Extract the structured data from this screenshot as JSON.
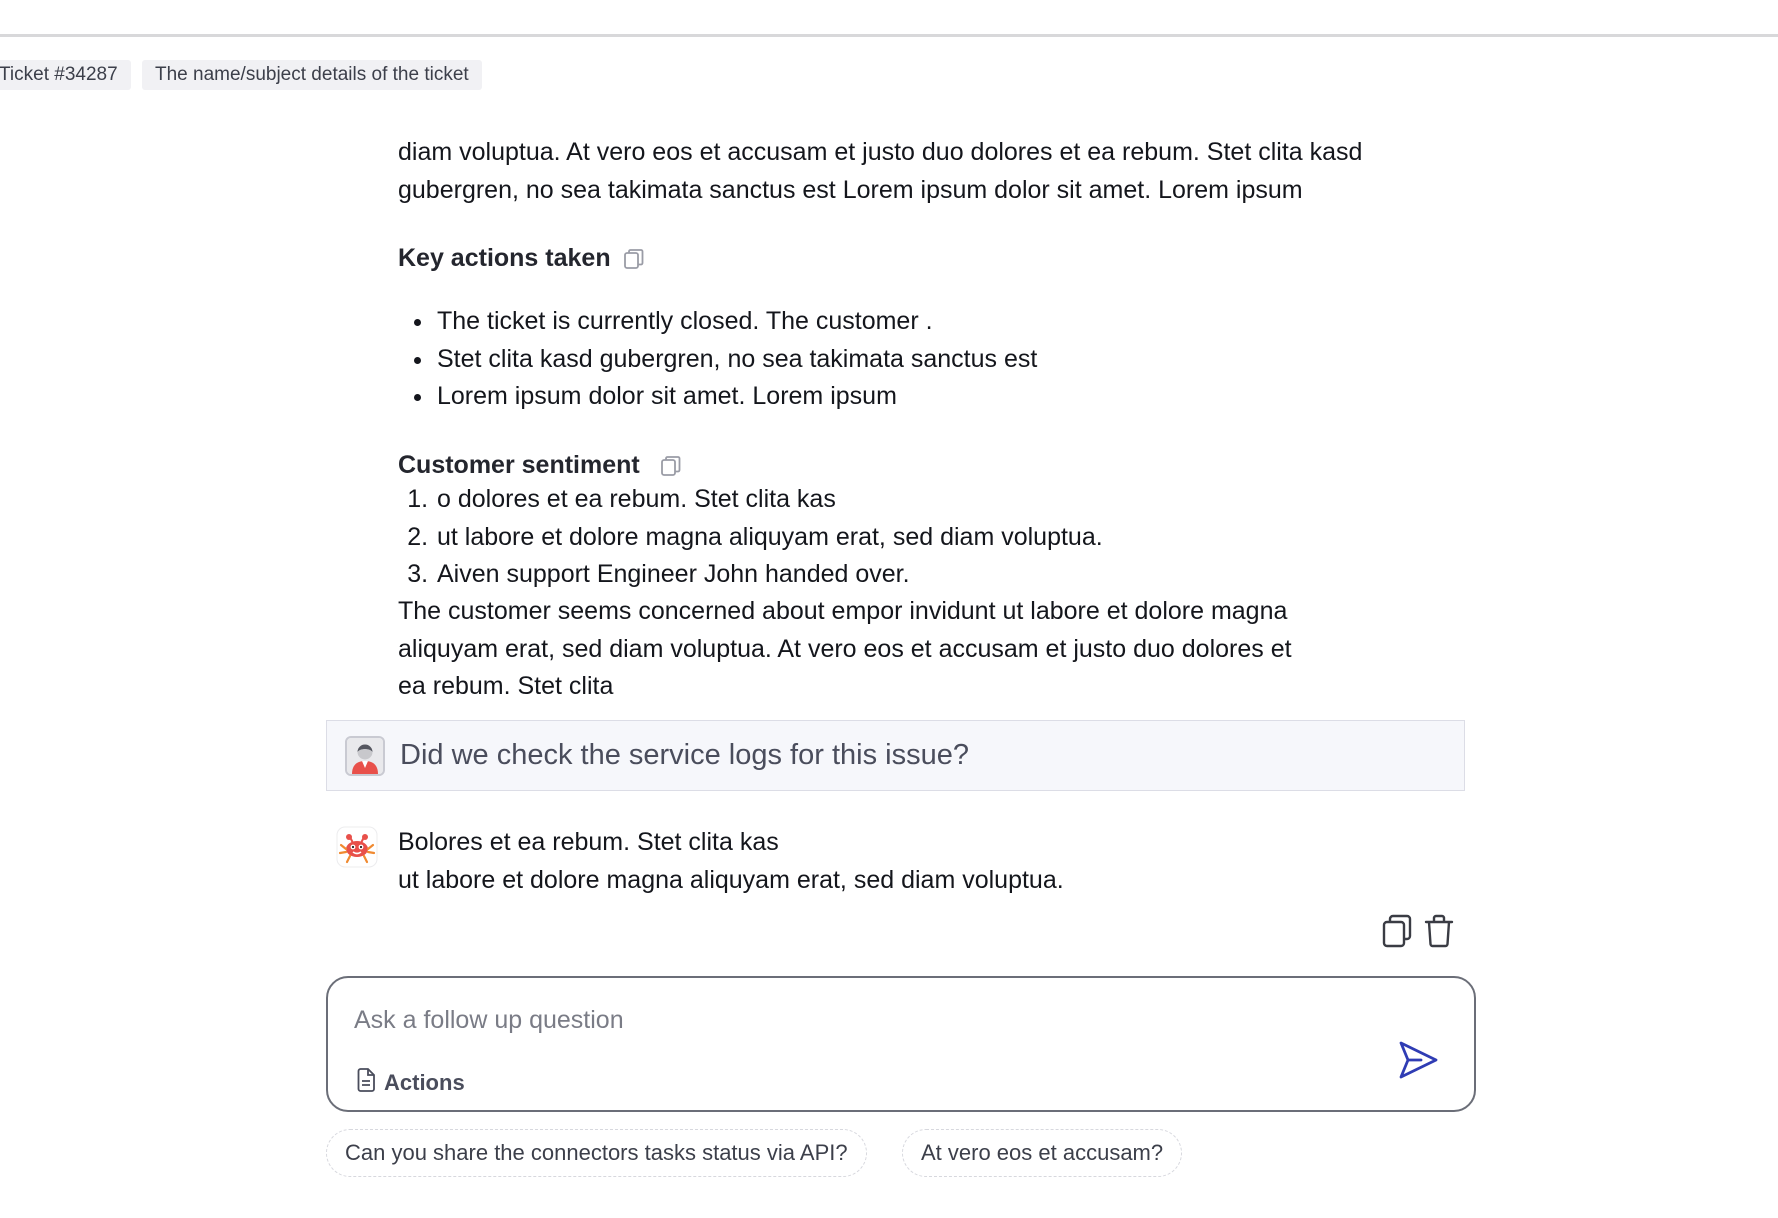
{
  "breadcrumb": {
    "ticket": "Ticket #34287",
    "subject": "The name/subject details of the ticket"
  },
  "summary": {
    "intro_text": "diam voluptua. At vero eos et accusam et justo duo dolores et ea rebum. Stet clita kasd\ngubergren, no sea takimata sanctus est Lorem ipsum dolor sit amet. Lorem ipsum",
    "key_actions": {
      "heading": "Key actions taken",
      "items": [
        "The ticket is currently closed. The customer .",
        "Stet clita kasd gubergren, no sea takimata sanctus est",
        "Lorem ipsum dolor sit amet. Lorem ipsum"
      ]
    },
    "sentiment": {
      "heading": "Customer sentiment",
      "items": [
        "o dolores et ea rebum. Stet clita kas",
        "ut labore et dolore magna aliquyam erat, sed diam voluptua.",
        "Aiven support Engineer John handed over."
      ],
      "text": "The customer seems concerned about empor invidunt ut labore et dolore magna\naliquyam erat, sed diam voluptua. At vero eos et accusam et justo duo dolores et\nea rebum. Stet clita"
    }
  },
  "conversation": {
    "user_question": "Did we check the service logs for this issue?",
    "bot_answer": "Bolores et ea rebum. Stet clita kas\nut labore et dolore magna aliquyam erat, sed diam voluptua."
  },
  "composer": {
    "placeholder": "Ask a follow up question",
    "actions_label": "Actions"
  },
  "suggestions": [
    "Can you share the connectors tasks status via API?",
    "At vero eos et accusam?"
  ],
  "colors": {
    "send_icon": "#2f3cb4",
    "bot_avatar": "#e8504a",
    "user_avatar_shirt": "#e8504a"
  },
  "icons": {
    "copy": "copy-icon",
    "delete": "trash-icon",
    "send": "send-icon",
    "actions": "document-icon"
  }
}
